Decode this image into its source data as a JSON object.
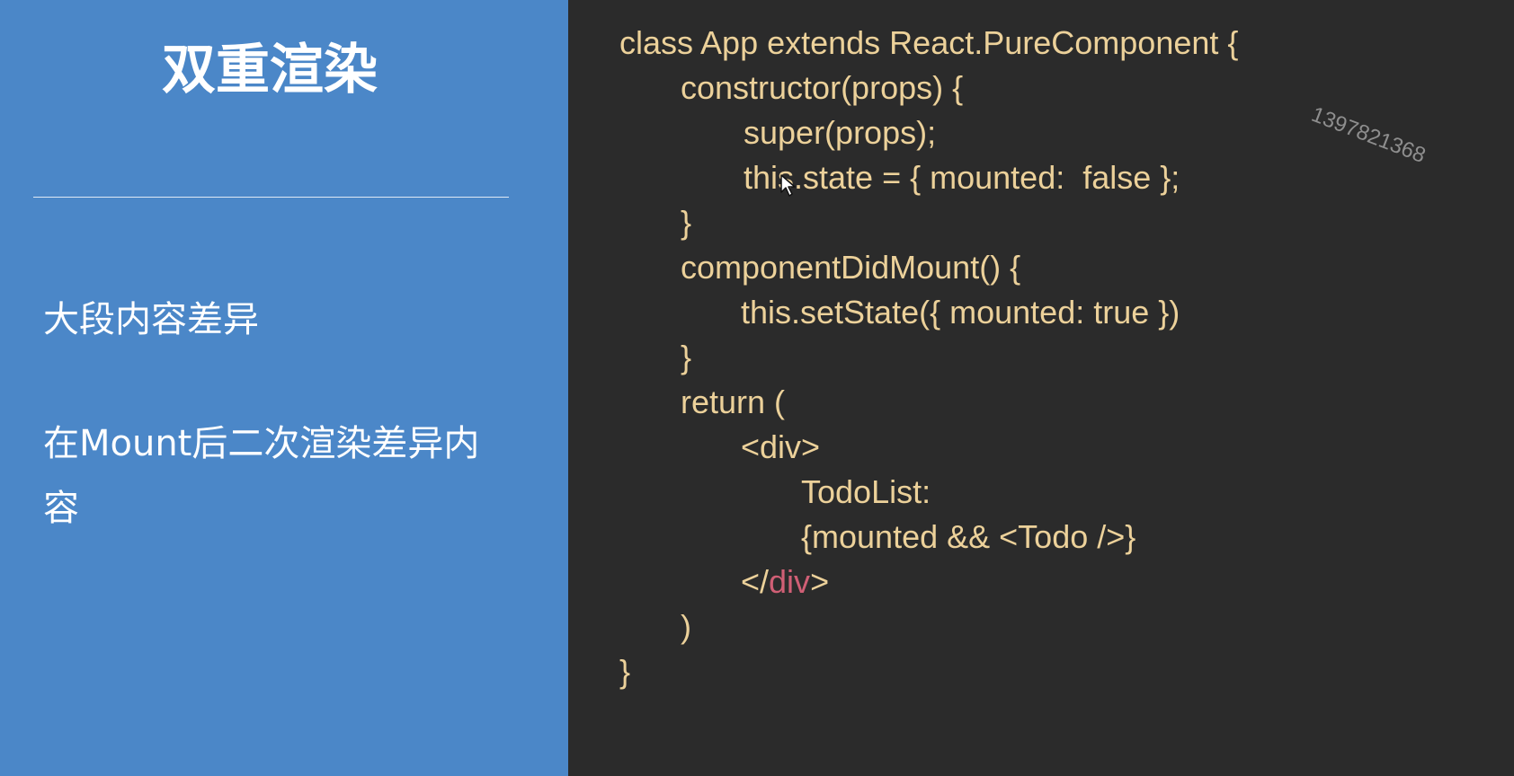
{
  "slide": {
    "title": "双重渲染",
    "bullets": [
      "大段内容差异",
      "在Mount后二次渲染差异内容"
    ]
  },
  "code": {
    "lines": [
      "class App extends React.PureComponent {",
      "constructor(props) {",
      "super(props);",
      "this.state = { mounted:  false };",
      "}",
      "componentDidMount() {",
      "this.setState({ mounted: true })",
      "}",
      "return (",
      "<div>",
      "TodoList:",
      "{mounted && <Todo />}",
      "</",
      "div",
      ">",
      ")",
      "}"
    ]
  },
  "watermark": "1397821368",
  "colors": {
    "left_background": "#4b87c8",
    "code_background": "#2b2b2b",
    "code_text": "#ecd19a",
    "tag_highlight": "#d05f75"
  },
  "icons": {
    "cursor": "mouse-pointer-icon"
  }
}
